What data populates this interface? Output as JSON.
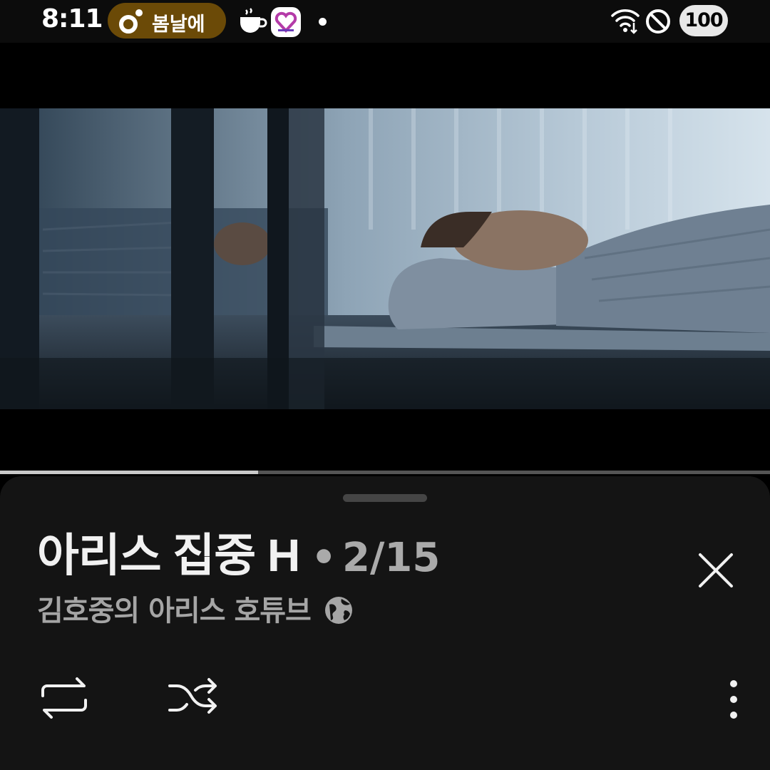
{
  "status_bar": {
    "time": "8:11",
    "media_chip": {
      "label": "봄날에",
      "icon": "music-note-icon",
      "color": "#6b4a07"
    },
    "app_icons": [
      "coffee-app-icon",
      "heart-app-icon"
    ],
    "notification_dot": true,
    "right_icons": [
      "wifi-icon",
      "do-not-disturb-icon"
    ],
    "battery": "100"
  },
  "player": {
    "progress": 0.335,
    "progress_color": "#c9c9c9"
  },
  "sheet": {
    "playlist_title": "아리스 집중 H",
    "separator": "•",
    "position": "2/15",
    "channel_name": "김호중의 아리스 호튜브",
    "visibility_icon": "globe-icon",
    "close_icon": "close-icon",
    "controls": [
      "loop-icon",
      "shuffle-icon",
      "more-vertical-icon"
    ]
  }
}
